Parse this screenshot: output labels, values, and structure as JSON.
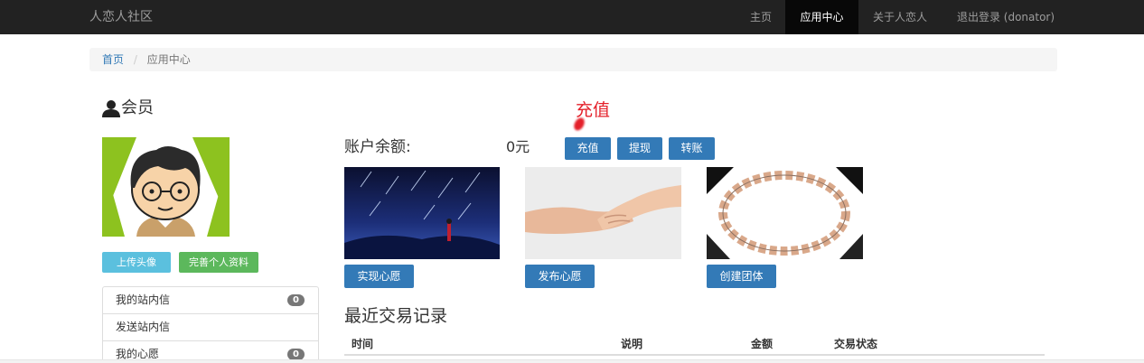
{
  "navbar": {
    "brand": "人恋人社区",
    "items": [
      {
        "label": "主页"
      },
      {
        "label": "应用中心"
      },
      {
        "label": "关于人恋人"
      },
      {
        "label": "退出登录 (donator)"
      }
    ]
  },
  "breadcrumb": {
    "home": "首页",
    "separator": "/",
    "current": "应用中心"
  },
  "member": {
    "title": "会员",
    "upload_avatar": "上传头像",
    "complete_profile": "完善个人资料"
  },
  "sidebar": {
    "items": [
      {
        "label": "我的站内信",
        "badge": "0"
      },
      {
        "label": "发送站内信"
      },
      {
        "label": "我的心愿",
        "badge": "0"
      }
    ]
  },
  "account": {
    "annotation": "充值",
    "balance_label": "账户余额:",
    "balance_value": "0元",
    "recharge": "充值",
    "withdraw": "提现",
    "transfer": "转账"
  },
  "actions": {
    "fulfill_wish": "实现心愿",
    "publish_wish": "发布心愿",
    "create_group": "创建团体"
  },
  "transactions": {
    "title": "最近交易记录",
    "columns": [
      "时间",
      "说明",
      "金额",
      "交易状态"
    ]
  },
  "colors": {
    "navbar": "#222222",
    "primary": "#337ab7",
    "info": "#5bc0de",
    "success": "#5cb85c",
    "annotation": "#e4202a"
  }
}
